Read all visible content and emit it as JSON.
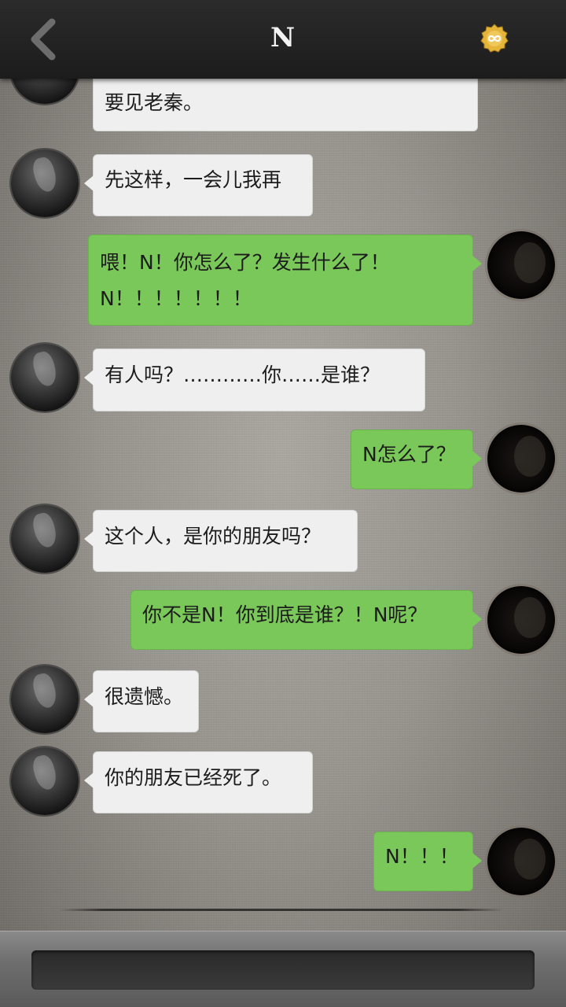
{
  "header": {
    "title": "N",
    "back_icon": "chevron-left-icon",
    "badge_icon": "infinity-badge-icon",
    "badge_color": "#e5b53a"
  },
  "messages": [
    {
      "side": "left",
      "text": "要见老秦。",
      "partial": true
    },
    {
      "side": "left",
      "text": "先这样，一会儿我再"
    },
    {
      "side": "right",
      "lines": [
        "喂！N！你怎么了？发生什么了！",
        "N！！！！！！！"
      ]
    },
    {
      "side": "left",
      "text": "有人吗？…………你……是谁？"
    },
    {
      "side": "right",
      "text": "N怎么了？"
    },
    {
      "side": "left",
      "text": "这个人，是你的朋友吗？"
    },
    {
      "side": "right",
      "text": "你不是N！你到底是谁？！N呢？"
    },
    {
      "side": "left",
      "text": "很遗憾。"
    },
    {
      "side": "left",
      "text": "你的朋友已经死了。"
    },
    {
      "side": "right",
      "text": "N！！！"
    }
  ],
  "colors": {
    "incoming_bubble": "#efefef",
    "outgoing_bubble": "#7ac85a",
    "header_bg": "#222222"
  },
  "input": {
    "value": "",
    "placeholder": ""
  }
}
